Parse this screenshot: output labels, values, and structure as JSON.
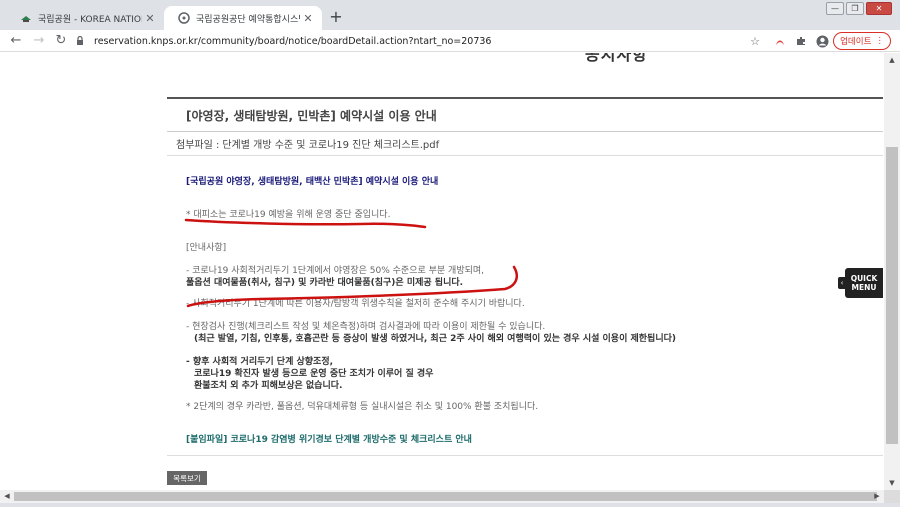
{
  "browser": {
    "tabs": [
      {
        "title": "국립공원 - KOREA NATIONAL P…",
        "active": false
      },
      {
        "title": "국립공원공단 예약통합시스템",
        "active": true
      }
    ],
    "new_tab": "+",
    "url": "reservation.knps.or.kr/community/board/notice/boardDetail.action?ntart_no=20736",
    "update_label": "업데이트",
    "window_buttons": {
      "minimize": "—",
      "restore": "❐",
      "close": "✕"
    }
  },
  "page": {
    "partial_heading": "공지사항",
    "board": {
      "title": "[야영장, 생태탐방원, 민박촌] 예약시설 이용 안내",
      "attachment_label": "첨부파일 :",
      "attachment_name": "단계별 개방 수준 및 코로나19 진단 체크리스트.pdf"
    },
    "content": {
      "heading": "[국립공원 야영장, 생태탐방원, 태백산 민박촌] 예약시설 이용 안내",
      "notice_1": "* 대피소는 코로나19 예방을 위해 운영 중단 중입니다.",
      "guide_title": "[안내사항]",
      "item_1a": "- 코로나19 사회적거리두기 1단계에서 야영장은 50% 수준으로 부분 개방되며,",
      "item_1b": "풀옵션 대여물품(취사, 침구) 및 카라반 대여물품(침구)은 미제공 됩니다.",
      "item_2": "- 사회적거리두기 1단계에 따른 이용자/탐방객 위생수칙을 철저히 준수해 주시기 바랍니다.",
      "item_3a": "- 현장검사 진행(체크리스트 작성 및 체온측정)하며 검사결과에 따라 이용이 제한될 수 있습니다.",
      "item_3b": "(최근 발열, 기침, 인후통, 호흡곤란 등 증상이 발생 하였거나, 최근 2주 사이 해외 여행력이 있는 경우 시설 이용이 제한됩니다)",
      "item_4a": "- 향후 사회적 거리두기 단계 상향조정,",
      "item_4b": "코로나19 확진자 발생 등으로 운영 중단 조치가 이루어 질 경우",
      "item_4c": "환불조치 외 추가 피해보상은 없습니다.",
      "notice_2": "* 2단계의 경우 카라반, 풀옵션, 덕유대체류형 등 실내시설은 취소 및 100% 환불 조치됩니다.",
      "attach_note": "[붙임파일] 코로나19 감염병 위기경보 단계별 개방수준 및 체크리스트 안내"
    },
    "list_button": "목록보기",
    "quick_menu": {
      "line1": "QUICK",
      "line2": "MENU",
      "arrow": "‹"
    }
  },
  "colors": {
    "annotation_red": "#cc1111",
    "navy": "#1a1a7a",
    "green": "#1d6b6b",
    "update_red": "#d93025"
  },
  "icons": [
    "park-favicon",
    "knps-favicon",
    "lock-icon",
    "star-icon",
    "pdf-extension-icon",
    "puzzle-extension-icon",
    "profile-icon",
    "menu-dots-icon"
  ]
}
